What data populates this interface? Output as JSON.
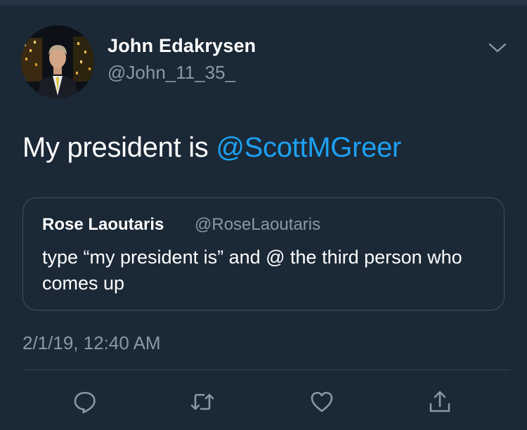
{
  "author": {
    "display_name": "John Edakrysen",
    "handle": "@John_11_35_"
  },
  "tweet": {
    "text_prefix": "My president is ",
    "mention": "@ScottMGreer"
  },
  "quoted_tweet": {
    "display_name": "Rose Laoutaris",
    "handle": "@RoseLaoutaris",
    "text": "type “my president is” and @ the third person who comes up"
  },
  "timestamp": "2/1/19, 12:40 AM",
  "actions": {
    "reply_icon": "reply-icon",
    "retweet_icon": "retweet-icon",
    "like_icon": "heart-icon",
    "share_icon": "share-icon"
  },
  "colors": {
    "background": "#1b2836",
    "accent": "#1da1f2",
    "secondary_text": "#8899a6"
  }
}
